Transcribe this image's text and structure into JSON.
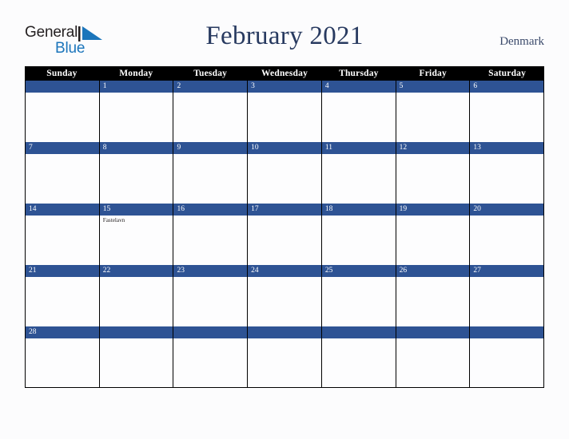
{
  "logo": {
    "word_one": "General",
    "word_two": "Blue",
    "triangle_color": "#1b75bb"
  },
  "header": {
    "title": "February 2021",
    "country": "Denmark"
  },
  "colors": {
    "header_bar": "#000000",
    "date_band": "#2e5394",
    "title_text": "#283a60",
    "country_text": "#3b4a6b",
    "page_background": "#fcfcfd"
  },
  "calendar": {
    "weekdays": [
      "Sunday",
      "Monday",
      "Tuesday",
      "Wednesday",
      "Thursday",
      "Friday",
      "Saturday"
    ],
    "weeks": [
      [
        {
          "date": "",
          "events": []
        },
        {
          "date": "1",
          "events": []
        },
        {
          "date": "2",
          "events": []
        },
        {
          "date": "3",
          "events": []
        },
        {
          "date": "4",
          "events": []
        },
        {
          "date": "5",
          "events": []
        },
        {
          "date": "6",
          "events": []
        }
      ],
      [
        {
          "date": "7",
          "events": []
        },
        {
          "date": "8",
          "events": []
        },
        {
          "date": "9",
          "events": []
        },
        {
          "date": "10",
          "events": []
        },
        {
          "date": "11",
          "events": []
        },
        {
          "date": "12",
          "events": []
        },
        {
          "date": "13",
          "events": []
        }
      ],
      [
        {
          "date": "14",
          "events": []
        },
        {
          "date": "15",
          "events": [
            "Fastelavn"
          ]
        },
        {
          "date": "16",
          "events": []
        },
        {
          "date": "17",
          "events": []
        },
        {
          "date": "18",
          "events": []
        },
        {
          "date": "19",
          "events": []
        },
        {
          "date": "20",
          "events": []
        }
      ],
      [
        {
          "date": "21",
          "events": []
        },
        {
          "date": "22",
          "events": []
        },
        {
          "date": "23",
          "events": []
        },
        {
          "date": "24",
          "events": []
        },
        {
          "date": "25",
          "events": []
        },
        {
          "date": "26",
          "events": []
        },
        {
          "date": "27",
          "events": []
        }
      ],
      [
        {
          "date": "28",
          "events": []
        },
        {
          "date": "",
          "events": []
        },
        {
          "date": "",
          "events": []
        },
        {
          "date": "",
          "events": []
        },
        {
          "date": "",
          "events": []
        },
        {
          "date": "",
          "events": []
        },
        {
          "date": "",
          "events": []
        }
      ]
    ]
  }
}
